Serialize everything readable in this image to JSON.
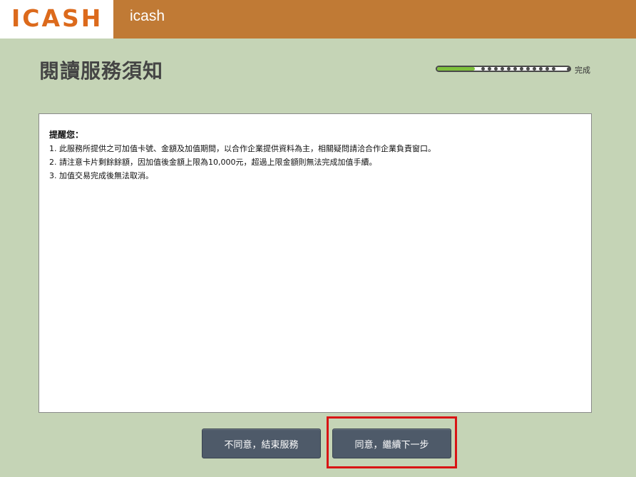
{
  "header": {
    "logo_text": "icash",
    "app_name": "icash"
  },
  "page": {
    "title": "閱讀服務須知"
  },
  "progress": {
    "label": "完成",
    "fraction": 0.28
  },
  "notice": {
    "heading": "提醒您：",
    "lines": [
      "1. 此服務所提供之可加值卡號、金額及加值期間，以合作企業提供資料為主，相關疑問請洽合作企業負責窗口。",
      "2. 請注意卡片剩餘餘額，因加值後金額上限為10,000元，超過上限金額則無法完成加值手續。",
      "3. 加值交易完成後無法取消。"
    ]
  },
  "buttons": {
    "disagree_label": "不同意，結束服務",
    "agree_label": "同意，繼續下一步"
  },
  "colors": {
    "background": "#c5d4b6",
    "header": "#c07a35",
    "logo": "#dc6a1c",
    "progress_fill": "#7ec03c",
    "button": "#4e5a69",
    "highlight": "#d81414"
  }
}
